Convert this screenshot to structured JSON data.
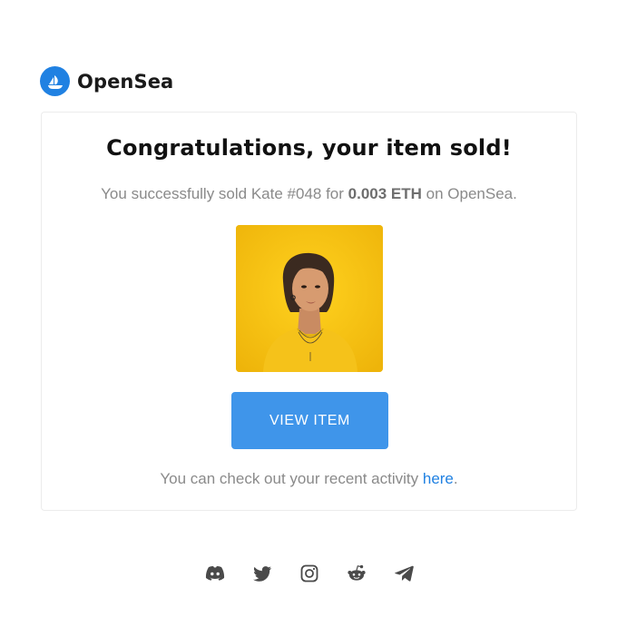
{
  "brand": {
    "name": "OpenSea",
    "logo_icon": "opensea-ship-icon",
    "accent_color": "#2081e2"
  },
  "card": {
    "headline": "Congratulations, your item sold!",
    "message": {
      "prefix": "You successfully sold Kate #048 for ",
      "amount": "0.003 ETH",
      "suffix": " on OpenSea."
    },
    "image_icon": "nft-portrait-image",
    "button_label": "VIEW ITEM",
    "activity": {
      "prefix": "You can check out your recent activity ",
      "link": "here",
      "suffix": "."
    }
  },
  "social": [
    {
      "name": "discord-icon"
    },
    {
      "name": "twitter-icon"
    },
    {
      "name": "instagram-icon"
    },
    {
      "name": "reddit-icon"
    },
    {
      "name": "telegram-icon"
    }
  ]
}
